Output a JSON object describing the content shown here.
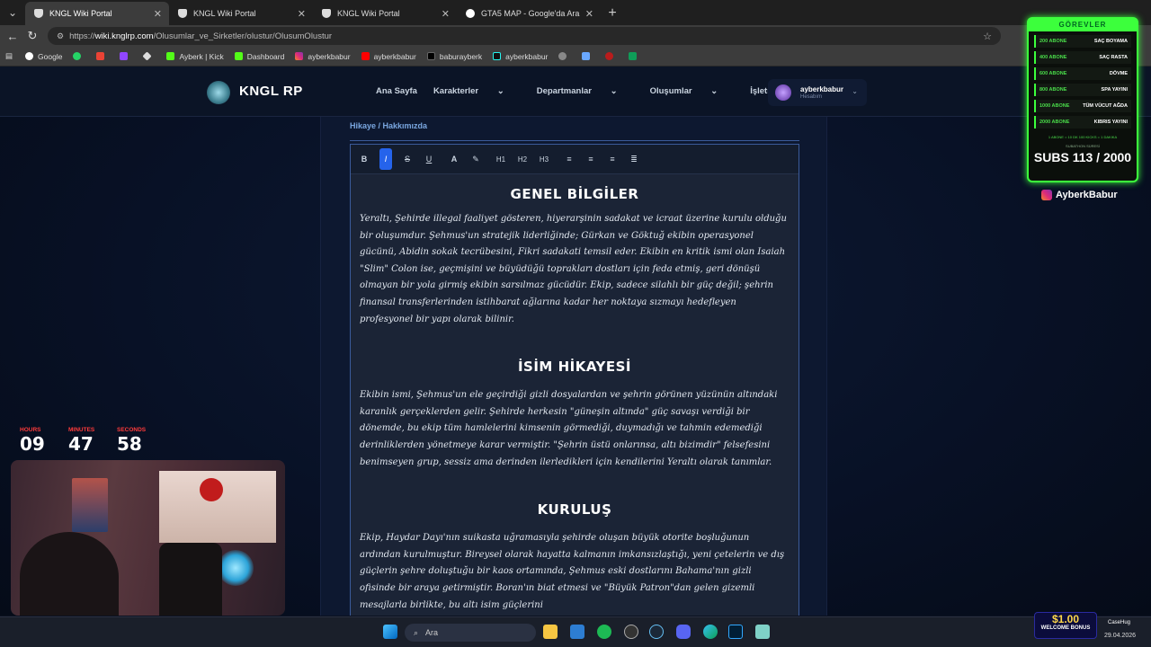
{
  "browser": {
    "tabs": [
      {
        "title": "KNGL Wiki Portal",
        "active": true
      },
      {
        "title": "KNGL Wiki Portal",
        "active": false
      },
      {
        "title": "KNGL Wiki Portal",
        "active": false
      },
      {
        "title": "GTA5 MAP - Google'da Ara",
        "active": false
      }
    ],
    "url_prefix": "https://",
    "url_host": "wiki.knglrp.com",
    "url_path": "/Olusumlar_ve_Sirketler/olustur/OlusumOlustur",
    "bookmarks": [
      "Google",
      "Ayberk | Kick",
      "Dashboard",
      "ayberkbabur",
      "ayberkbabur",
      "baburayberk",
      "ayberkbabur"
    ]
  },
  "site": {
    "logo": "KNGL RP",
    "nav": [
      "Ana Sayfa",
      "Karakterler",
      "Departmanlar",
      "Oluşumlar",
      "İşletmeler"
    ],
    "account_name": "ayberkbabur",
    "account_sub": "Hesabım",
    "section_label": "Hikaye / Hakkımızda",
    "toolbar": [
      "B",
      "I",
      "S",
      "U",
      "A",
      "H1",
      "H2",
      "H3"
    ]
  },
  "editor": {
    "h_genel": "GENEL BİLGİLER",
    "p_genel": "Yeraltı, Şehirde illegal faaliyet gösteren, hiyerarşinin sadakat ve icraat üzerine kurulu olduğu bir oluşumdur. Şehmus'un stratejik liderliğinde; Gürkan ve Göktuğ ekibin operasyonel gücünü, Abidin sokak tecrübesini, Fikri sadakati temsil eder. Ekibin en kritik ismi olan Isaiah \"Slim\" Colon ise, geçmişini ve büyüdüğü toprakları dostları için feda etmiş, geri dönüşü olmayan bir yola girmiş ekibin sarsılmaz gücüdür. Ekip, sadece silahlı bir güç değil; şehrin finansal transferlerinden istihbarat ağlarına kadar her noktaya sızmayı hedefleyen profesyonel bir yapı olarak bilinir.",
    "h_isim": "İSİM HİKAYESİ",
    "p_isim": "Ekibin ismi, Şehmus'un ele geçirdiği gizli dosyalardan ve şehrin görünen yüzünün altındaki karanlık gerçeklerden gelir. Şehirde herkesin \"güneşin altında\" güç savaşı verdiği bir dönemde, bu ekip tüm hamlelerini kimsenin görmediği, duymadığı ve tahmin edemediği derinliklerden yönetmeye karar vermiştir. \"Şehrin üstü onlarınsa, altı bizimdir\" felsefesini benimseyen grup, sessiz ama derinden ilerledikleri için kendilerini Yeraltı olarak tanımlar.",
    "h_kurulus": "KURULUŞ",
    "p_kurulus": "Ekip, Haydar Dayı'nın suikasta uğramasıyla şehirde oluşan büyük otorite boşluğunun ardından kurulmuştur. Bireysel olarak hayatta kalmanın imkansızlaştığı, yeni çetelerin ve dış güçlerin şehre doluştuğu bir kaos ortamında, Şehmus eski dostlarını Bahama'nın gizli ofisinde bir araya getirmiştir. Boran'ın biat etmesi ve \"Büyük Patron\"dan gelen gizemli mesajlarla birlikte, bu altı isim güçlerini"
  },
  "overlay": {
    "goals_title": "GÖREVLER",
    "goals": [
      {
        "goal": "200 ABONE",
        "task": "SAÇ BOYAMA"
      },
      {
        "goal": "400 ABONE",
        "task": "SAÇ RASTA"
      },
      {
        "goal": "600 ABONE",
        "task": "DÖVME"
      },
      {
        "goal": "800 ABONE",
        "task": "SPA YAYINI"
      },
      {
        "goal": "1000 ABONE",
        "task": "TÜM VÜCUT AĞDA"
      },
      {
        "goal": "2000 ABONE",
        "task": "KIBRIS YAYINI"
      }
    ],
    "goals_note": "1 ABONE = 10 DK   100 KICKS = 1 DAKIKA",
    "subs_caption": "SUBATHON SÜRESİ",
    "subs": "SUBS 113 / 2000",
    "instagram": "AyberkBabur",
    "timer": [
      {
        "label": "HOURS",
        "value": "09"
      },
      {
        "label": "MINUTES",
        "value": "47"
      },
      {
        "label": "SECONDS",
        "value": "58"
      }
    ],
    "bonus_amount": "$1.00",
    "bonus_label": "WELCOME BONUS",
    "bonus_brand": "CaseHug"
  },
  "taskbar": {
    "search_placeholder": "Ara",
    "date": "29.04.2026"
  }
}
